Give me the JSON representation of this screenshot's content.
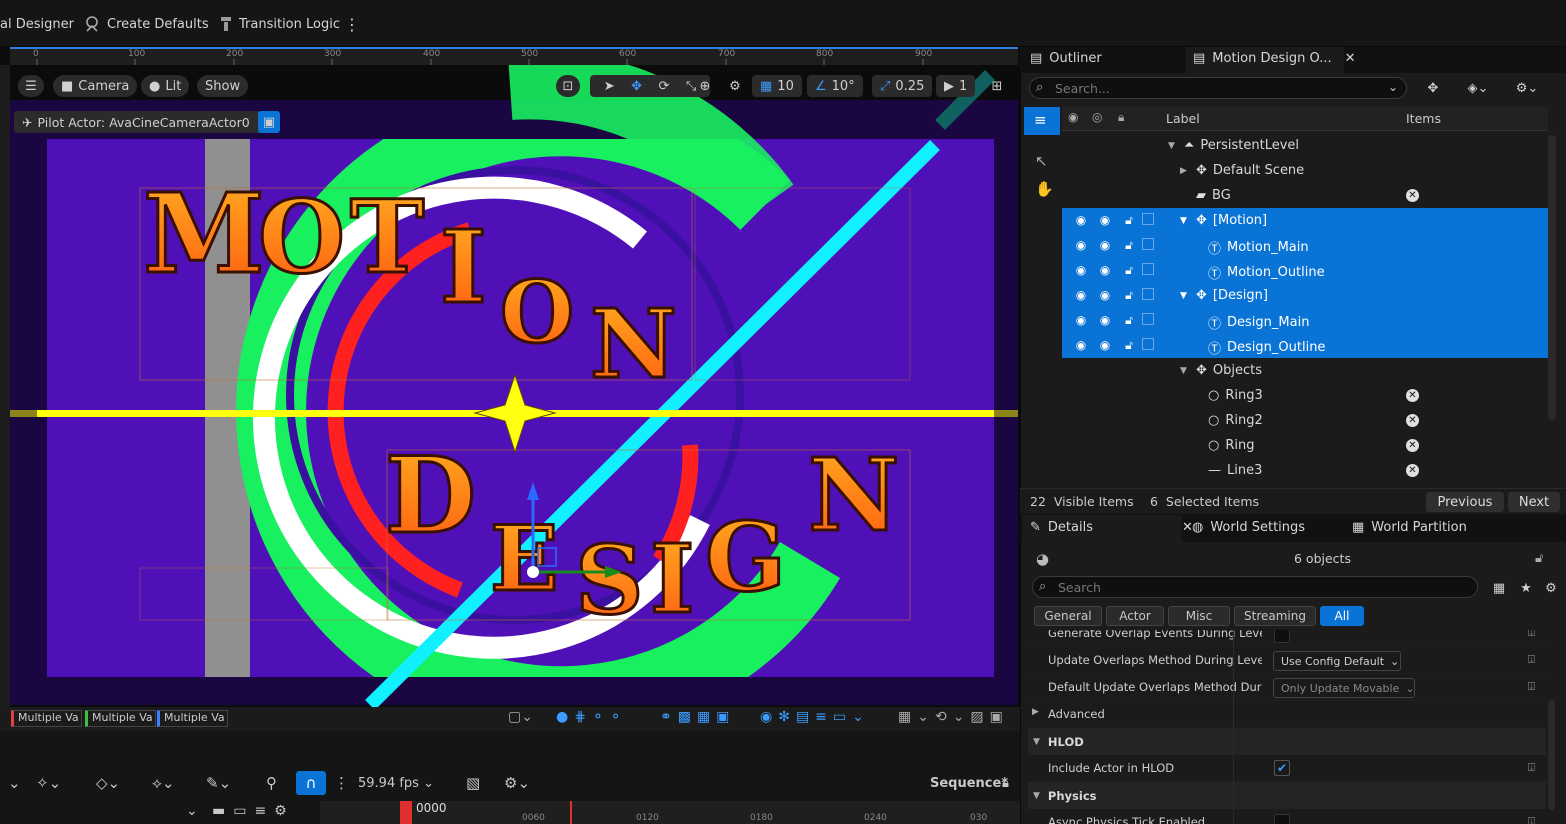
{
  "toolbar": {
    "item1": "al Designer",
    "item2": "Create Defaults",
    "item3": "Transition Logic",
    "more": "⋮"
  },
  "ruler": {
    "ticks": [
      "0",
      "100",
      "200",
      "300",
      "400",
      "500",
      "600",
      "700",
      "800",
      "900"
    ]
  },
  "viewport": {
    "camera": "Camera",
    "lit": "Lit",
    "show": "Show",
    "pilot": "Pilot Actor: AvaCineCameraActor0",
    "grid": "10",
    "angle": "10°",
    "scale": "0.25",
    "camspeed": "1",
    "scene_text": {
      "motion_letters": [
        "M",
        "O",
        "T",
        "I",
        "O",
        "N"
      ],
      "design_letters": [
        "D",
        "E",
        "S",
        "I",
        "G",
        "N"
      ]
    }
  },
  "vpbottom": {
    "tags": [
      "Multiple Va",
      "Multiple Va",
      "Multiple Va"
    ],
    "tag_colors": [
      "#e04040",
      "#40c040",
      "#4080ff"
    ]
  },
  "timeline": {
    "fps": "59.94 fps",
    "sequence": "Sequence*",
    "frame": "0000",
    "ticks": [
      "0060",
      "0120",
      "0180",
      "0240",
      "030"
    ]
  },
  "outliner": {
    "tab1": "Outliner",
    "tab2": "Motion Design O...",
    "search_placeholder": "Search...",
    "col_label": "Label",
    "col_items": "Items",
    "rows": [
      {
        "label": "PersistentLevel",
        "depth": 0,
        "selected": false,
        "icon": "level-icon",
        "expand": "open",
        "x": false
      },
      {
        "label": "Default Scene",
        "depth": 1,
        "selected": false,
        "icon": "actor-icon",
        "expand": "closed",
        "x": false
      },
      {
        "label": "BG",
        "depth": 1,
        "selected": false,
        "icon": "plane-icon",
        "expand": "none",
        "x": true
      },
      {
        "label": "[Motion]",
        "depth": 1,
        "selected": true,
        "icon": "actor-icon",
        "expand": "open",
        "x": false
      },
      {
        "label": "Motion_Main",
        "depth": 2,
        "selected": true,
        "icon": "text-icon",
        "expand": "none",
        "x": false
      },
      {
        "label": "Motion_Outline",
        "depth": 2,
        "selected": true,
        "icon": "text-icon",
        "expand": "none",
        "x": false
      },
      {
        "label": "[Design]",
        "depth": 1,
        "selected": true,
        "icon": "actor-icon",
        "expand": "open",
        "x": false
      },
      {
        "label": "Design_Main",
        "depth": 2,
        "selected": true,
        "icon": "text-icon",
        "expand": "none",
        "x": false
      },
      {
        "label": "Design_Outline",
        "depth": 2,
        "selected": true,
        "icon": "text-icon",
        "expand": "none",
        "x": false
      },
      {
        "label": "Objects",
        "depth": 1,
        "selected": false,
        "icon": "actor-icon",
        "expand": "open",
        "x": false
      },
      {
        "label": "Ring3",
        "depth": 2,
        "selected": false,
        "icon": "ring-icon",
        "expand": "none",
        "x": true
      },
      {
        "label": "Ring2",
        "depth": 2,
        "selected": false,
        "icon": "ring-icon",
        "expand": "none",
        "x": true
      },
      {
        "label": "Ring",
        "depth": 2,
        "selected": false,
        "icon": "ring-icon",
        "expand": "none",
        "x": true
      },
      {
        "label": "Line3",
        "depth": 2,
        "selected": false,
        "icon": "line-icon",
        "expand": "none",
        "x": true
      }
    ],
    "visible_items": "22  Visible Items",
    "selected_items": "6  Selected Items",
    "previous": "Previous",
    "next": "Next"
  },
  "details": {
    "tab1": "Details",
    "tab2": "World Settings",
    "tab3": "World Partition",
    "objects": "6 objects",
    "search_placeholder": "Search",
    "categories": [
      "General",
      "Actor",
      "Misc",
      "Streaming",
      "All"
    ],
    "rows": {
      "cut": "Generate Overlap Events During Level St...",
      "update_label": "Update Overlaps Method During Level St...",
      "update_value": "Use Config Default",
      "default_label": "Default Update Overlaps Method During...",
      "default_value": "Only Update Movable",
      "advanced": "Advanced",
      "hlod": "HLOD",
      "include_hlod": "Include Actor in HLOD",
      "physics": "Physics",
      "async": "Async Physics Tick Enabled"
    }
  }
}
